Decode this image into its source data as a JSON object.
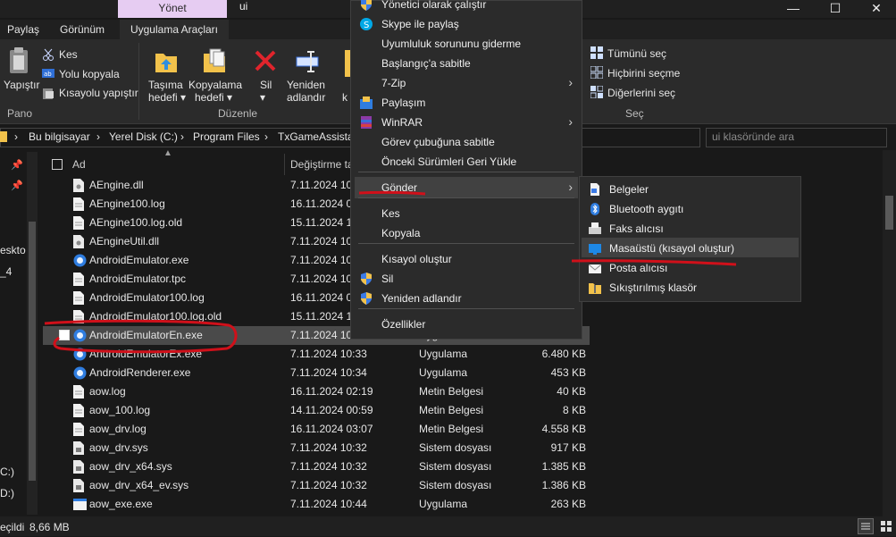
{
  "window": {
    "title": "ui",
    "context_tab": "Yönet",
    "minimize": "—",
    "maximize": "☐",
    "close": "✕"
  },
  "ribbon_tabs": [
    "Paylaş",
    "Görünüm",
    "Uygulama Araçları"
  ],
  "ribbon": {
    "pano_label": "Pano",
    "paste": "Yapıştır",
    "cut": "Kes",
    "copy_path": "Yolu kopyala",
    "paste_shortcut": "Kısayolu yapıştır",
    "move_to": [
      "Taşıma",
      "hedefi"
    ],
    "copy_to": [
      "Kopyalama",
      "hedefi"
    ],
    "delete": "Sil",
    "rename": [
      "Yeniden",
      "adlandır"
    ],
    "duzenle_label": "Düzenle",
    "select_all": "Tümünü seç",
    "select_none": "Hiçbirini seçme",
    "invert": "Diğerlerini seç",
    "sec_label": "Seç"
  },
  "address": {
    "crumbs": [
      "Bu bilgisayar",
      "Yerel Disk (C:)",
      "Program Files",
      "TxGameAssistan"
    ],
    "search_placeholder": "ui klasöründe ara"
  },
  "nav_fragments": [
    "eskto",
    "_4",
    "C:)",
    "D:)"
  ],
  "columns": {
    "name": "Ad",
    "date": "Değiştirme ta"
  },
  "files": [
    {
      "name": "AEngine.dll",
      "date": "7.11.2024 10:",
      "type": "",
      "size": "",
      "icon": "dll"
    },
    {
      "name": "AEngine100.log",
      "date": "16.11.2024 02",
      "type": "",
      "size": "",
      "icon": "doc"
    },
    {
      "name": "AEngine100.log.old",
      "date": "15.11.2024 16",
      "type": "",
      "size": "",
      "icon": "doc"
    },
    {
      "name": "AEngineUtil.dll",
      "date": "7.11.2024 10:",
      "type": "",
      "size": "",
      "icon": "dll"
    },
    {
      "name": "AndroidEmulator.exe",
      "date": "7.11.2024 10:",
      "type": "",
      "size": "",
      "icon": "exe"
    },
    {
      "name": "AndroidEmulator.tpc",
      "date": "7.11.2024 10:",
      "type": "",
      "size": "",
      "icon": "doc"
    },
    {
      "name": "AndroidEmulator100.log",
      "date": "16.11.2024 02",
      "type": "",
      "size": "",
      "icon": "doc"
    },
    {
      "name": "AndroidEmulator100.log.old",
      "date": "15.11.2024 14",
      "type": "",
      "size": "",
      "icon": "doc"
    },
    {
      "name": "AndroidEmulatorEn.exe",
      "date": "7.11.2024 10:33",
      "type": "Uygulama",
      "size": "",
      "icon": "exe"
    },
    {
      "name": "AndroidEmulatorEx.exe",
      "date": "7.11.2024 10:33",
      "type": "Uygulama",
      "size": "6.480 KB",
      "icon": "exe"
    },
    {
      "name": "AndroidRenderer.exe",
      "date": "7.11.2024 10:34",
      "type": "Uygulama",
      "size": "453 KB",
      "icon": "exe"
    },
    {
      "name": "aow.log",
      "date": "16.11.2024 02:19",
      "type": "Metin Belgesi",
      "size": "40 KB",
      "icon": "doc"
    },
    {
      "name": "aow_100.log",
      "date": "14.11.2024 00:59",
      "type": "Metin Belgesi",
      "size": "8 KB",
      "icon": "doc"
    },
    {
      "name": "aow_drv.log",
      "date": "16.11.2024 03:07",
      "type": "Metin Belgesi",
      "size": "4.558 KB",
      "icon": "doc"
    },
    {
      "name": "aow_drv.sys",
      "date": "7.11.2024 10:32",
      "type": "Sistem dosyası",
      "size": "917 KB",
      "icon": "sys"
    },
    {
      "name": "aow_drv_x64.sys",
      "date": "7.11.2024 10:32",
      "type": "Sistem dosyası",
      "size": "1.385 KB",
      "icon": "sys"
    },
    {
      "name": "aow_drv_x64_ev.sys",
      "date": "7.11.2024 10:32",
      "type": "Sistem dosyası",
      "size": "1.386 KB",
      "icon": "sys"
    },
    {
      "name": "aow_exe.exe",
      "date": "7.11.2024 10:44",
      "type": "Uygulama",
      "size": "263 KB",
      "icon": "exe2"
    }
  ],
  "context_menu": [
    {
      "label": "Yönetici olarak çalıştır",
      "icon": "shield-icon",
      "arrow": false
    },
    {
      "label": "Skype ile paylaş",
      "icon": "skype-icon",
      "arrow": false
    },
    {
      "label": "Uyumluluk sorununu giderme",
      "icon": "",
      "arrow": false
    },
    {
      "label": "Başlangıç'a sabitle",
      "icon": "",
      "arrow": false
    },
    {
      "label": "7-Zip",
      "icon": "",
      "arrow": true
    },
    {
      "label": "Paylaşım",
      "icon": "share-icon",
      "arrow": false
    },
    {
      "label": "WinRAR",
      "icon": "winrar-icon",
      "arrow": true
    },
    {
      "label": "Görev çubuğuna sabitle",
      "icon": "",
      "arrow": false
    },
    {
      "label": "Önceki Sürümleri Geri Yükle",
      "icon": "",
      "arrow": false
    },
    {
      "label": "Gönder",
      "icon": "",
      "arrow": true
    },
    {
      "label": "Kes",
      "icon": "",
      "arrow": false
    },
    {
      "label": "Kopyala",
      "icon": "",
      "arrow": false
    },
    {
      "label": "Kısayol oluştur",
      "icon": "",
      "arrow": false
    },
    {
      "label": "Sil",
      "icon": "shield-icon",
      "arrow": false
    },
    {
      "label": "Yeniden adlandır",
      "icon": "shield-icon",
      "arrow": false
    },
    {
      "label": "Özellikler",
      "icon": "",
      "arrow": false
    }
  ],
  "send_to_menu": [
    {
      "label": "Belgeler",
      "icon": "documents-icon"
    },
    {
      "label": "Bluetooth aygıtı",
      "icon": "bluetooth-icon"
    },
    {
      "label": "Faks alıcısı",
      "icon": "fax-icon"
    },
    {
      "label": "Masaüstü (kısayol oluştur)",
      "icon": "desktop-icon"
    },
    {
      "label": "Posta alıcısı",
      "icon": "mail-icon"
    },
    {
      "label": "Sıkıştırılmış klasör",
      "icon": "zip-folder-icon"
    }
  ],
  "status": {
    "selected_label": "eçildi",
    "selected_size": "8,66 MB"
  },
  "colors": {
    "accent_purple": "#e6ccf2",
    "annotation_red": "#d0101a",
    "selection": "#4a4a4a"
  }
}
